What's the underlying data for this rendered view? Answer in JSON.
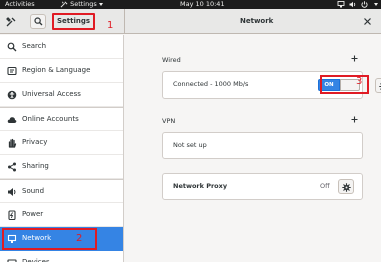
{
  "topbar": {
    "activities": "Activities",
    "app_name": "Settings",
    "clock": "May 10  10:41"
  },
  "headerbar": {
    "left_title": "Settings",
    "main_title": "Network"
  },
  "annotations": {
    "a1": "1",
    "a2": "2",
    "a3": "3"
  },
  "sidebar": {
    "items": [
      {
        "label": "Search",
        "icon": "search-icon"
      },
      {
        "label": "Region & Language",
        "icon": "region-icon"
      },
      {
        "label": "Universal Access",
        "icon": "accessibility-icon"
      },
      {
        "label": "Online Accounts",
        "icon": "online-accounts-icon"
      },
      {
        "label": "Privacy",
        "icon": "privacy-hand-icon"
      },
      {
        "label": "Sharing",
        "icon": "sharing-icon"
      },
      {
        "label": "Sound",
        "icon": "speaker-icon"
      },
      {
        "label": "Power",
        "icon": "power-icon"
      },
      {
        "label": "Network",
        "icon": "network-icon",
        "selected": true
      },
      {
        "label": "Devices",
        "icon": "devices-icon"
      }
    ]
  },
  "main": {
    "wired": {
      "label": "Wired",
      "status": "Connected - 1000 Mb/s",
      "toggle_state": "ON"
    },
    "vpn": {
      "label": "VPN",
      "status": "Not set up"
    },
    "proxy": {
      "label": "Network Proxy",
      "status": "Off"
    }
  },
  "colors": {
    "accent": "#3584e4",
    "annotation": "#e01b24",
    "topbar": "#1c1c1c"
  }
}
